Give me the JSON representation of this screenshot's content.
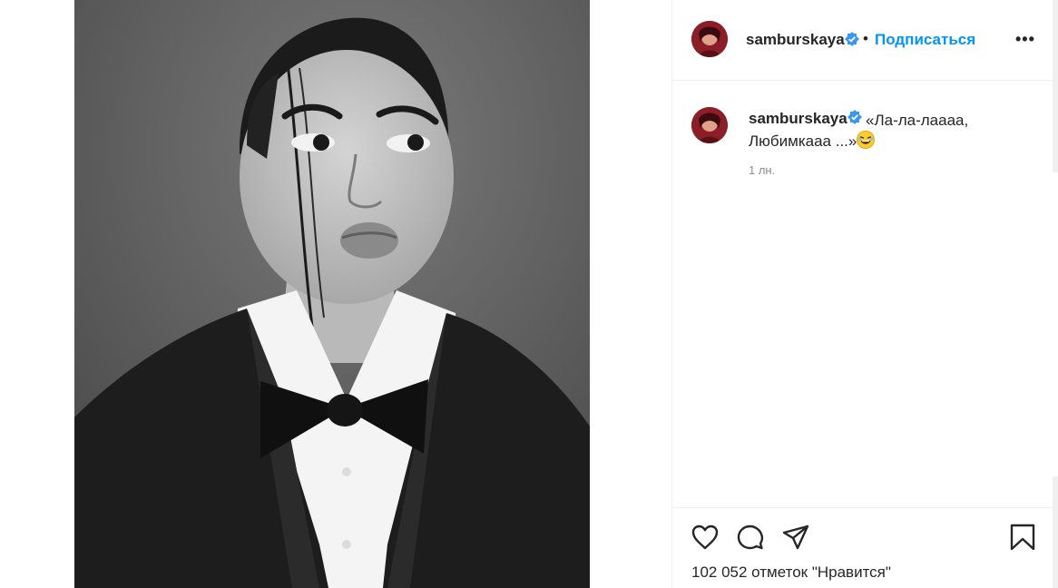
{
  "post": {
    "username": "samburskaya",
    "follow_label": "Подписаться",
    "separator": "•",
    "more_label": "•••"
  },
  "comment": {
    "username": "samburskaya",
    "caption_line1": "«Ла-ла-лаааа,",
    "caption_line2": "Любимкааа ...»",
    "age": "1 лн."
  },
  "actions": {
    "likes": "102 052 отметок \"Нравится\""
  },
  "colors": {
    "accent": "#0095f6",
    "verified": "#3897f0",
    "text": "#262626",
    "muted": "#8e8e8e"
  },
  "icons": [
    "verified-badge-icon",
    "heart-icon",
    "comment-icon",
    "share-icon",
    "bookmark-icon",
    "more-icon"
  ]
}
